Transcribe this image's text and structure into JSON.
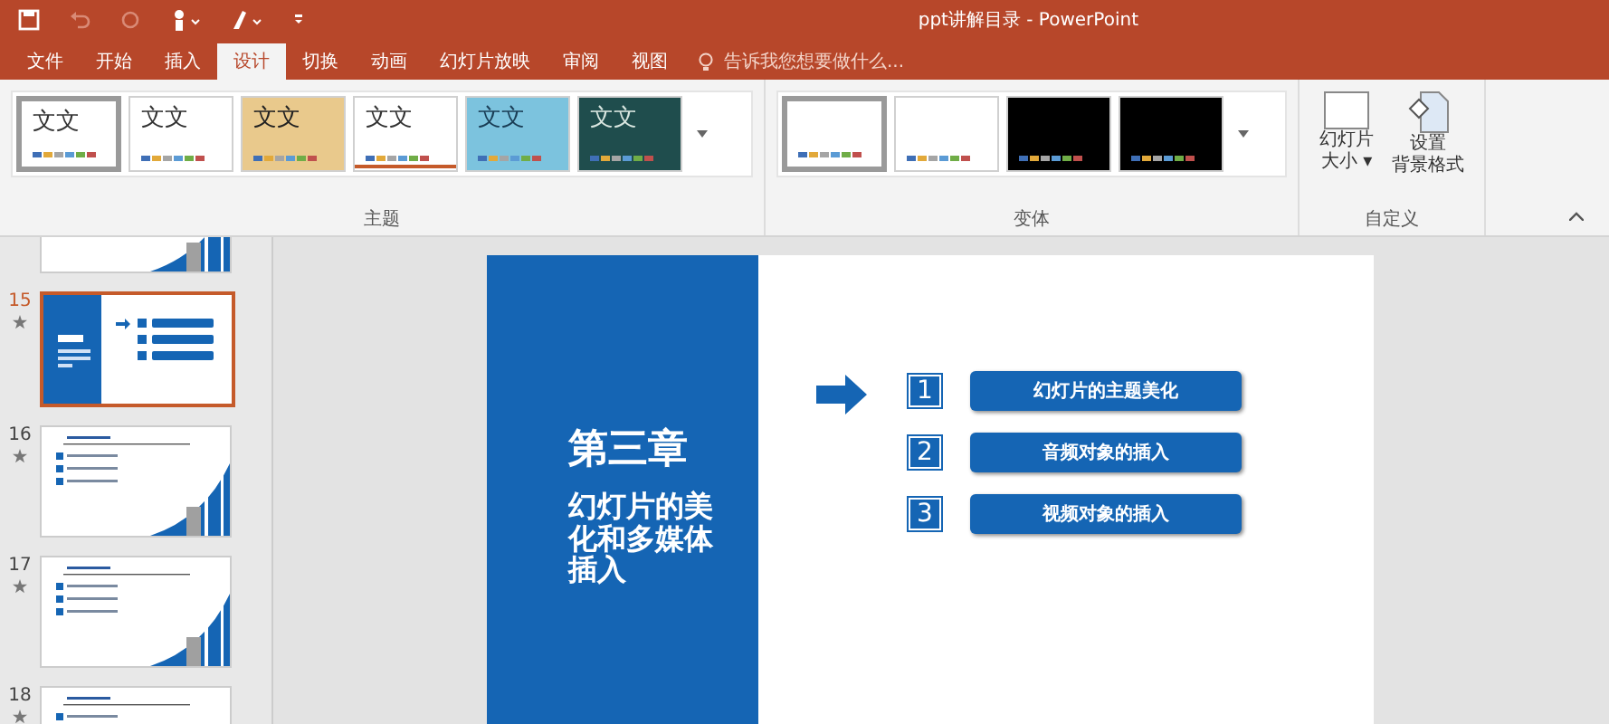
{
  "window": {
    "title": "ppt讲解目录 - PowerPoint"
  },
  "tabs": [
    {
      "label": "文件",
      "selected": false
    },
    {
      "label": "开始",
      "selected": false
    },
    {
      "label": "插入",
      "selected": false
    },
    {
      "label": "设计",
      "selected": true
    },
    {
      "label": "切换",
      "selected": false
    },
    {
      "label": "动画",
      "selected": false
    },
    {
      "label": "幻灯片放映",
      "selected": false
    },
    {
      "label": "审阅",
      "selected": false
    },
    {
      "label": "视图",
      "selected": false
    }
  ],
  "search": {
    "placeholder": "告诉我您想要做什么..."
  },
  "ribbon": {
    "themes": {
      "label": "主题",
      "items": [
        {
          "text": "文文",
          "kind": "plain",
          "selected": true
        },
        {
          "text": "文文",
          "kind": "plain",
          "selected": false
        },
        {
          "text": "文文",
          "kind": "parchment",
          "selected": false
        },
        {
          "text": "文文",
          "kind": "underline",
          "selected": false
        },
        {
          "text": "文文",
          "kind": "pattern",
          "selected": false
        },
        {
          "text": "文文",
          "kind": "dark-teal",
          "selected": false
        }
      ]
    },
    "variants": {
      "label": "变体",
      "items": [
        {
          "kind": "light",
          "selected": true
        },
        {
          "kind": "light",
          "selected": false
        },
        {
          "kind": "dark",
          "selected": false
        },
        {
          "kind": "dark",
          "selected": false
        }
      ]
    },
    "customize": {
      "label": "自定义",
      "buttons": [
        {
          "kind": "slide-size",
          "lines": [
            "幻灯片",
            "大小 ▾"
          ]
        },
        {
          "kind": "background",
          "lines": [
            "设置",
            "背景格式"
          ]
        }
      ]
    }
  },
  "slides": [
    {
      "kind": "list",
      "selected": false
    },
    {
      "number": "15",
      "kind": "title",
      "selected": true
    },
    {
      "number": "16",
      "kind": "list",
      "selected": false
    },
    {
      "number": "17",
      "kind": "list",
      "selected": false
    },
    {
      "number": "18",
      "kind": "list",
      "selected": false
    }
  ],
  "slide": {
    "chapter": "第三章",
    "subtitle": "幻灯片的美化和多媒体插入",
    "items": [
      {
        "number": "1",
        "text": "幻灯片的主题美化"
      },
      {
        "number": "2",
        "text": "音频对象的插入"
      },
      {
        "number": "3",
        "text": "视频对象的插入"
      }
    ]
  }
}
